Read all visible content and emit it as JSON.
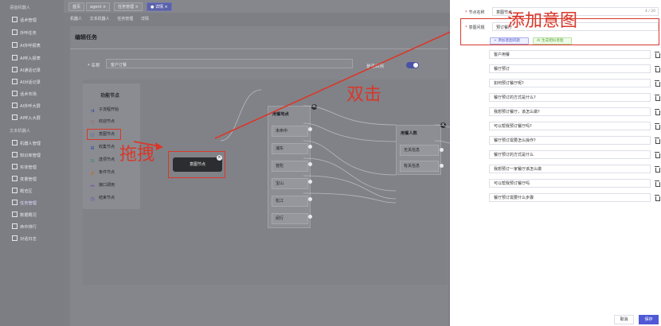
{
  "sidebar": {
    "items": [
      {
        "label": "语音机器人",
        "type": "group"
      },
      {
        "label": "话术管理",
        "type": "sub"
      },
      {
        "label": "外呼任务",
        "type": "sub"
      },
      {
        "label": "AI外呼报表",
        "type": "sub"
      },
      {
        "label": "AI呼入报表",
        "type": "sub"
      },
      {
        "label": "AI通话记录",
        "type": "sub"
      },
      {
        "label": "AI对话记录",
        "type": "sub"
      },
      {
        "label": "话术市场",
        "type": "sub"
      },
      {
        "label": "AI外呼大屏",
        "type": "sub"
      },
      {
        "label": "AI呼入大屏",
        "type": "sub"
      },
      {
        "label": "文本机器人",
        "type": "group"
      },
      {
        "label": "机器人管理",
        "type": "sub"
      },
      {
        "label": "知识库管理",
        "type": "sub"
      },
      {
        "label": "实体管理",
        "type": "sub"
      },
      {
        "label": "变量管理",
        "type": "sub"
      },
      {
        "label": "概览区",
        "type": "sub"
      },
      {
        "label": "任务管理",
        "type": "sub",
        "active": true
      },
      {
        "label": "数据概况",
        "type": "sub"
      },
      {
        "label": "命中排行",
        "type": "sub"
      },
      {
        "label": "对话日志",
        "type": "sub"
      }
    ]
  },
  "tabs": [
    {
      "label": "首页"
    },
    {
      "label": "agent ×"
    },
    {
      "label": "任务管理 ×"
    },
    {
      "label": "● 详情 ×",
      "active": true
    }
  ],
  "breadcrumb": [
    "机器人",
    "文本机器人",
    "任务管理",
    "详情"
  ],
  "page": {
    "title": "编辑任务",
    "name_label": "* 名称",
    "name_value": "客户订餐",
    "enable_label": "是否启用",
    "enable_on": true
  },
  "palette": {
    "title": "功能节点",
    "items": [
      {
        "label": "子流程开始",
        "icon": "flow-start-icon",
        "glyph": "⇉"
      },
      {
        "label": "欢迎节点",
        "icon": "heart-icon",
        "glyph": "♡"
      },
      {
        "label": "意图节点",
        "icon": "intent-icon",
        "glyph": "⚇"
      },
      {
        "label": "收集节点",
        "icon": "collect-icon",
        "glyph": "⊞"
      },
      {
        "label": "选项节点",
        "icon": "option-icon",
        "glyph": "⊙"
      },
      {
        "label": "条件节点",
        "icon": "condition-icon",
        "glyph": "⇵"
      },
      {
        "label": "接口调用",
        "icon": "api-icon",
        "glyph": "⚯"
      },
      {
        "label": "结束节点",
        "icon": "end-icon",
        "glyph": "◷"
      }
    ]
  },
  "dropped_node": {
    "label": "意图节点"
  },
  "flow_cards": [
    {
      "title": "用餐地点",
      "rows": [
        "未命中",
        "浦东",
        "普陀",
        "宝山",
        "松江",
        "闵行"
      ]
    },
    {
      "title": "用餐人数",
      "rows": [
        "无关信息",
        "有关信息"
      ]
    }
  ],
  "drawer": {
    "node_name_label": "节点名称",
    "node_name_value": "意图节点",
    "node_name_count": "4 / 20",
    "intent_q_label": "意图问题",
    "intent_q_value": "预订餐厅",
    "add_intent_btn": "+ 添加意图问题",
    "ai_gen_btn": "AI 生成相似意图",
    "similar_questions": [
      "客户用餐",
      "餐厅预订",
      "如何预订餐厅呢?",
      "餐厅预订的方式是什么?",
      "我想预订餐厅，该怎么做?",
      "可以帮我预订餐厅吗?",
      "餐厅预订需要怎么操作?",
      "餐厅预订的方式是什么",
      "我想预订一家餐厅该怎么做",
      "可以帮我预订餐厅吗",
      "餐厅预订需要什么步骤"
    ],
    "cancel_btn": "取消",
    "save_btn": "保存"
  },
  "annotations": {
    "add_intent": "添加意图",
    "double_click": "双击",
    "drag": "拖拽"
  },
  "colors": {
    "annotation_red": "#d8382b",
    "primary": "#4f59d6",
    "sidebar_bg": "#7d7e84"
  }
}
